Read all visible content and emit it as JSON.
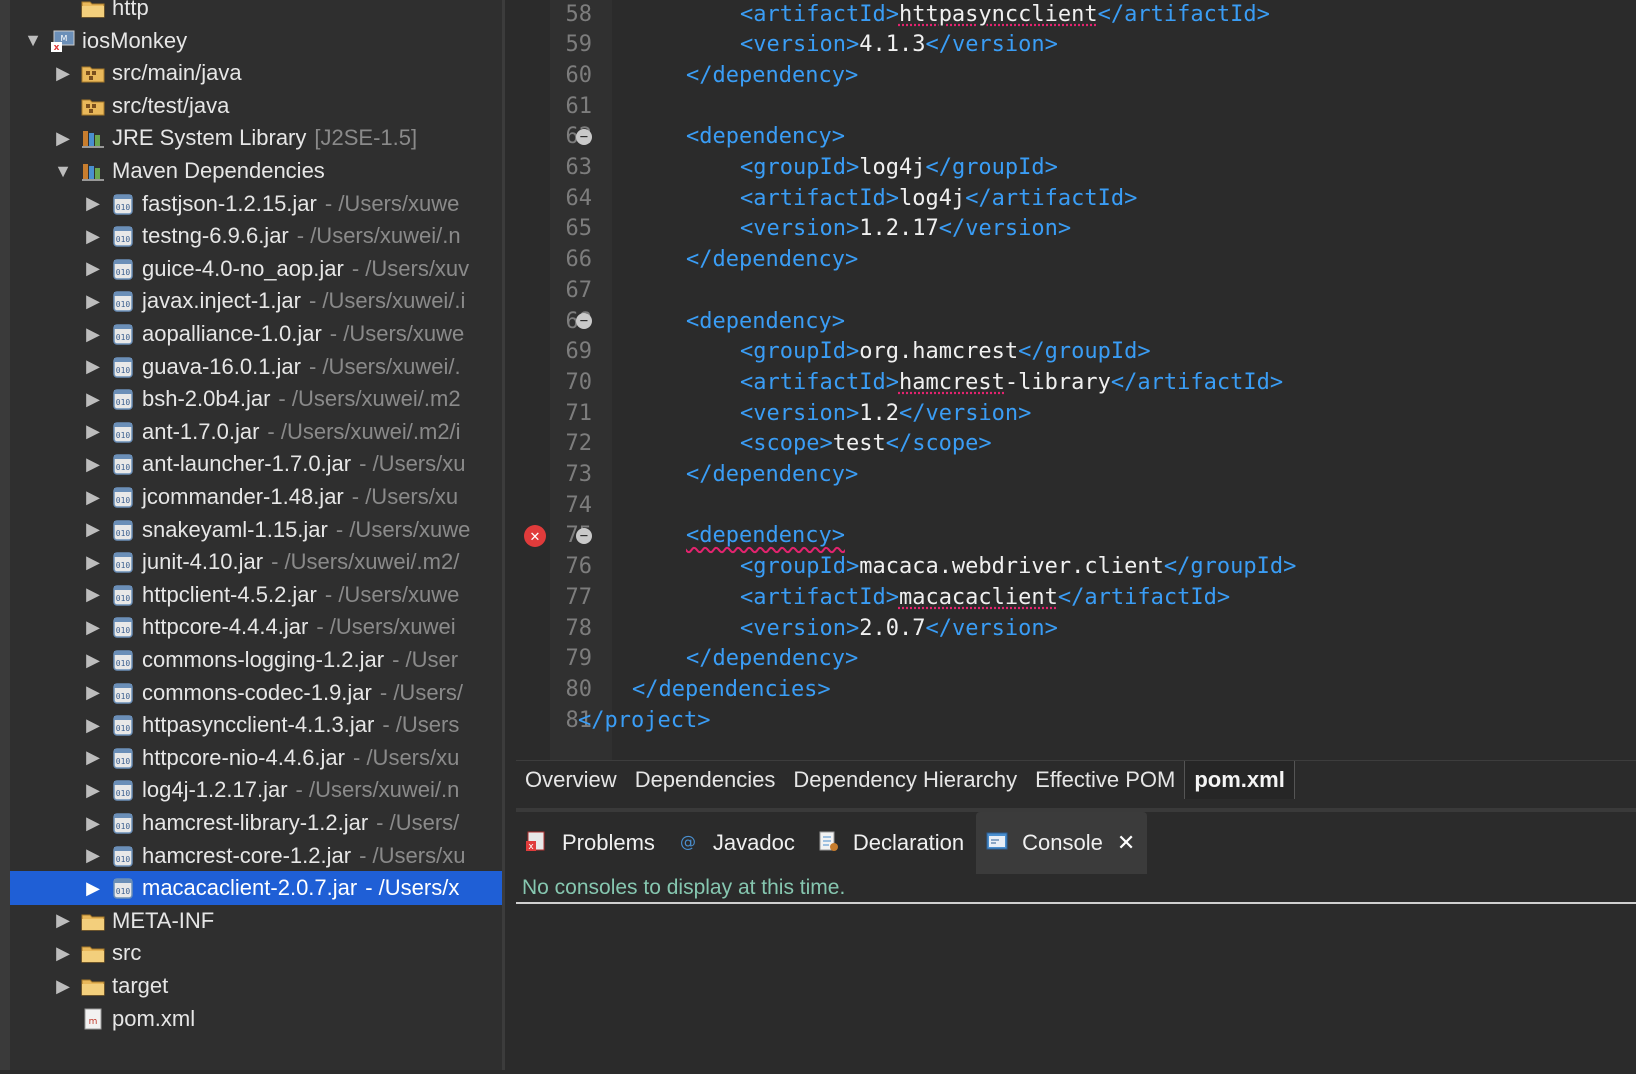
{
  "explorer": {
    "rows": [
      {
        "indent": 1,
        "twisty": "",
        "icon": "folder-icon",
        "label": "http",
        "deco": ""
      },
      {
        "indent": 0,
        "twisty": "▼",
        "icon": "maven-project-icon",
        "label": "iosMonkey",
        "deco": ""
      },
      {
        "indent": 1,
        "twisty": "▶",
        "icon": "source-folder-icon",
        "label": "src/main/java",
        "deco": ""
      },
      {
        "indent": 1,
        "twisty": "",
        "icon": "source-folder-icon",
        "label": "src/test/java",
        "deco": ""
      },
      {
        "indent": 1,
        "twisty": "▶",
        "icon": "library-icon",
        "label": "JRE System Library",
        "deco": "[J2SE-1.5]"
      },
      {
        "indent": 1,
        "twisty": "▼",
        "icon": "library-icon",
        "label": "Maven Dependencies",
        "deco": ""
      },
      {
        "indent": 2,
        "twisty": "▶",
        "icon": "jar-icon",
        "label": "fastjson-1.2.15.jar",
        "deco": "- /Users/xuwe"
      },
      {
        "indent": 2,
        "twisty": "▶",
        "icon": "jar-icon",
        "label": "testng-6.9.6.jar",
        "deco": "- /Users/xuwei/.n"
      },
      {
        "indent": 2,
        "twisty": "▶",
        "icon": "jar-icon",
        "label": "guice-4.0-no_aop.jar",
        "deco": "- /Users/xuv"
      },
      {
        "indent": 2,
        "twisty": "▶",
        "icon": "jar-icon",
        "label": "javax.inject-1.jar",
        "deco": "- /Users/xuwei/.i"
      },
      {
        "indent": 2,
        "twisty": "▶",
        "icon": "jar-icon",
        "label": "aopalliance-1.0.jar",
        "deco": "- /Users/xuwe"
      },
      {
        "indent": 2,
        "twisty": "▶",
        "icon": "jar-icon",
        "label": "guava-16.0.1.jar",
        "deco": "- /Users/xuwei/."
      },
      {
        "indent": 2,
        "twisty": "▶",
        "icon": "jar-icon",
        "label": "bsh-2.0b4.jar",
        "deco": "- /Users/xuwei/.m2"
      },
      {
        "indent": 2,
        "twisty": "▶",
        "icon": "jar-icon",
        "label": "ant-1.7.0.jar",
        "deco": "- /Users/xuwei/.m2/i"
      },
      {
        "indent": 2,
        "twisty": "▶",
        "icon": "jar-icon",
        "label": "ant-launcher-1.7.0.jar",
        "deco": "- /Users/xu"
      },
      {
        "indent": 2,
        "twisty": "▶",
        "icon": "jar-icon",
        "label": "jcommander-1.48.jar",
        "deco": "- /Users/xu"
      },
      {
        "indent": 2,
        "twisty": "▶",
        "icon": "jar-icon",
        "label": "snakeyaml-1.15.jar",
        "deco": "- /Users/xuwe"
      },
      {
        "indent": 2,
        "twisty": "▶",
        "icon": "jar-icon",
        "label": "junit-4.10.jar",
        "deco": "- /Users/xuwei/.m2/"
      },
      {
        "indent": 2,
        "twisty": "▶",
        "icon": "jar-icon",
        "label": "httpclient-4.5.2.jar",
        "deco": "- /Users/xuwe"
      },
      {
        "indent": 2,
        "twisty": "▶",
        "icon": "jar-icon",
        "label": "httpcore-4.4.4.jar",
        "deco": "- /Users/xuwei"
      },
      {
        "indent": 2,
        "twisty": "▶",
        "icon": "jar-icon",
        "label": "commons-logging-1.2.jar",
        "deco": "- /User"
      },
      {
        "indent": 2,
        "twisty": "▶",
        "icon": "jar-icon",
        "label": "commons-codec-1.9.jar",
        "deco": "- /Users/"
      },
      {
        "indent": 2,
        "twisty": "▶",
        "icon": "jar-icon",
        "label": "httpasyncclient-4.1.3.jar",
        "deco": "- /Users"
      },
      {
        "indent": 2,
        "twisty": "▶",
        "icon": "jar-icon",
        "label": "httpcore-nio-4.4.6.jar",
        "deco": "- /Users/xu"
      },
      {
        "indent": 2,
        "twisty": "▶",
        "icon": "jar-icon",
        "label": "log4j-1.2.17.jar",
        "deco": "- /Users/xuwei/.n"
      },
      {
        "indent": 2,
        "twisty": "▶",
        "icon": "jar-icon",
        "label": "hamcrest-library-1.2.jar",
        "deco": "- /Users/"
      },
      {
        "indent": 2,
        "twisty": "▶",
        "icon": "jar-icon",
        "label": "hamcrest-core-1.2.jar",
        "deco": "- /Users/xu"
      },
      {
        "indent": 2,
        "twisty": "▶",
        "icon": "jar-icon",
        "label": "macacaclient-2.0.7.jar",
        "deco": "- /Users/x",
        "selected": true
      },
      {
        "indent": 1,
        "twisty": "▶",
        "icon": "folder-icon",
        "label": "META-INF",
        "deco": ""
      },
      {
        "indent": 1,
        "twisty": "▶",
        "icon": "folder-icon",
        "label": "src",
        "deco": ""
      },
      {
        "indent": 1,
        "twisty": "▶",
        "icon": "folder-icon",
        "label": "target",
        "deco": ""
      },
      {
        "indent": 1,
        "twisty": "",
        "icon": "xml-file-icon",
        "label": "pom.xml",
        "deco": ""
      }
    ]
  },
  "editor": {
    "lines": [
      {
        "n": "58",
        "indent": 3,
        "parts": [
          [
            "tag",
            "<artifactId>"
          ],
          [
            "val-squig",
            "httpasyncclient"
          ],
          [
            "tag",
            "</artifactId>"
          ]
        ]
      },
      {
        "n": "59",
        "indent": 3,
        "parts": [
          [
            "tag",
            "<version>"
          ],
          [
            "val",
            "4.1.3"
          ],
          [
            "tag",
            "</version>"
          ]
        ]
      },
      {
        "n": "60",
        "indent": 2,
        "parts": [
          [
            "tag",
            "</dependency>"
          ]
        ]
      },
      {
        "n": "61",
        "indent": 0,
        "parts": []
      },
      {
        "n": "62",
        "indent": 2,
        "fold": true,
        "parts": [
          [
            "tag",
            "<dependency>"
          ]
        ]
      },
      {
        "n": "63",
        "indent": 3,
        "parts": [
          [
            "tag",
            "<groupId>"
          ],
          [
            "val",
            "log4j"
          ],
          [
            "tag",
            "</groupId>"
          ]
        ]
      },
      {
        "n": "64",
        "indent": 3,
        "parts": [
          [
            "tag",
            "<artifactId>"
          ],
          [
            "val",
            "log4j"
          ],
          [
            "tag",
            "</artifactId>"
          ]
        ]
      },
      {
        "n": "65",
        "indent": 3,
        "parts": [
          [
            "tag",
            "<version>"
          ],
          [
            "val",
            "1.2.17"
          ],
          [
            "tag",
            "</version>"
          ]
        ]
      },
      {
        "n": "66",
        "indent": 2,
        "parts": [
          [
            "tag",
            "</dependency>"
          ]
        ]
      },
      {
        "n": "67",
        "indent": 0,
        "parts": []
      },
      {
        "n": "68",
        "indent": 2,
        "fold": true,
        "parts": [
          [
            "tag",
            "<dependency>"
          ]
        ]
      },
      {
        "n": "69",
        "indent": 3,
        "parts": [
          [
            "tag",
            "<groupId>"
          ],
          [
            "val",
            "org.hamcrest"
          ],
          [
            "tag",
            "</groupId>"
          ]
        ]
      },
      {
        "n": "70",
        "indent": 3,
        "parts": [
          [
            "tag",
            "<artifactId>"
          ],
          [
            "val-squig",
            "hamcrest"
          ],
          [
            "val",
            "-library"
          ],
          [
            "tag",
            "</artifactId>"
          ]
        ]
      },
      {
        "n": "71",
        "indent": 3,
        "parts": [
          [
            "tag",
            "<version>"
          ],
          [
            "val",
            "1.2"
          ],
          [
            "tag",
            "</version>"
          ]
        ]
      },
      {
        "n": "72",
        "indent": 3,
        "parts": [
          [
            "tag",
            "<scope>"
          ],
          [
            "val",
            "test"
          ],
          [
            "tag",
            "</scope>"
          ]
        ]
      },
      {
        "n": "73",
        "indent": 2,
        "parts": [
          [
            "tag",
            "</dependency>"
          ]
        ]
      },
      {
        "n": "74",
        "indent": 0,
        "parts": []
      },
      {
        "n": "75",
        "indent": 2,
        "fold": true,
        "error": true,
        "parts": [
          [
            "tag-squig",
            "<dependency>"
          ]
        ]
      },
      {
        "n": "76",
        "indent": 3,
        "parts": [
          [
            "tag",
            "<groupId>"
          ],
          [
            "val",
            "macaca.webdriver.client"
          ],
          [
            "tag",
            "</groupId>"
          ]
        ]
      },
      {
        "n": "77",
        "indent": 3,
        "parts": [
          [
            "tag",
            "<artifactId>"
          ],
          [
            "val-squig",
            "macacaclient"
          ],
          [
            "tag",
            "</artifactId>"
          ]
        ]
      },
      {
        "n": "78",
        "indent": 3,
        "parts": [
          [
            "tag",
            "<version>"
          ],
          [
            "val",
            "2.0.7"
          ],
          [
            "tag",
            "</version>"
          ]
        ]
      },
      {
        "n": "79",
        "indent": 2,
        "parts": [
          [
            "tag",
            "</dependency>"
          ]
        ]
      },
      {
        "n": "80",
        "indent": 1,
        "parts": [
          [
            "tag",
            "</dependencies>"
          ]
        ]
      },
      {
        "n": "81",
        "indent": 0,
        "parts": [
          [
            "tag",
            "</project>"
          ]
        ]
      }
    ],
    "tabs": [
      "Overview",
      "Dependencies",
      "Dependency Hierarchy",
      "Effective POM",
      "pom.xml"
    ],
    "active_tab": "pom.xml"
  },
  "bottom": {
    "tabs": [
      {
        "label": "Problems",
        "icon": "problems-icon"
      },
      {
        "label": "Javadoc",
        "icon": "javadoc-icon"
      },
      {
        "label": "Declaration",
        "icon": "declaration-icon"
      },
      {
        "label": "Console",
        "icon": "console-icon",
        "active": true,
        "close": "✕"
      }
    ],
    "console_message": "No consoles to display at this time."
  },
  "colors": {
    "tag": "#3a9df5",
    "selection": "#1f5fd6",
    "console_text": "#86c7b0",
    "error": "#e03b3b"
  }
}
